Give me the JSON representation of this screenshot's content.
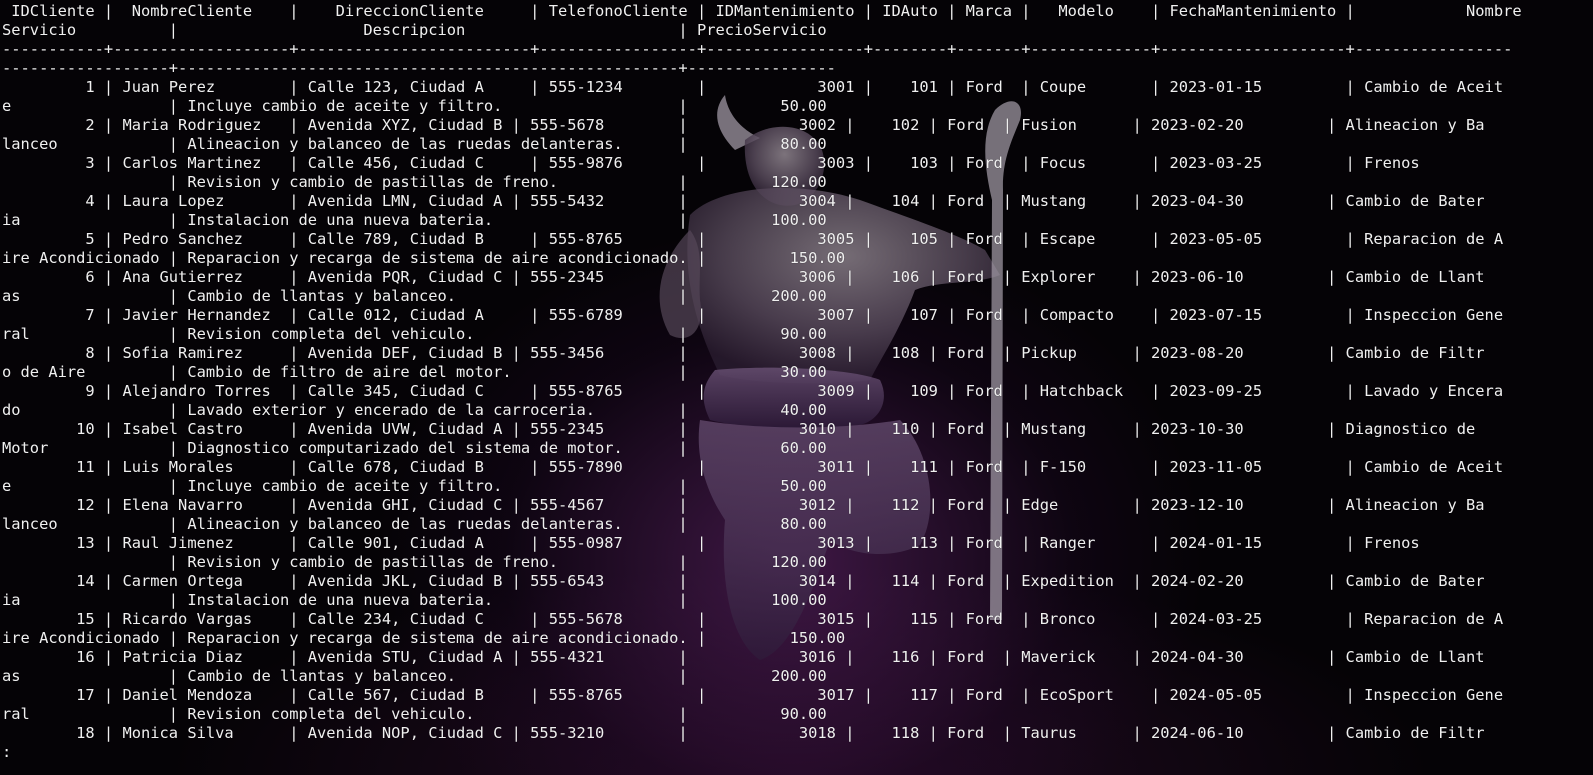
{
  "terminal": {
    "background_color": "#050306",
    "text_color": "#f0f0f0",
    "wallpaper": "minotaur-figure-with-staff",
    "lines": [
      " IDCliente |  NombreCliente    |    DireccionCliente     | TelefonoCliente | IDMantenimiento | IDAuto | Marca |   Modelo    | FechaMantenimiento |            Nombre",
      "Servicio          |                    Descripcion                       | PrecioServicio",
      "-----------+-------------------+-------------------------+-----------------+-----------------+--------+-------+-------------+--------------------+-----------------",
      "------------------+------------------------------------------------------+----------------",
      "         1 | Juan Perez        | Calle 123, Ciudad A     | 555-1234        |            3001 |    101 | Ford  | Coupe       | 2023-01-15         | Cambio de Aceit",
      "e                 | Incluye cambio de aceite y filtro.                   |          50.00",
      "         2 | Maria Rodriguez   | Avenida XYZ, Ciudad B | 555-5678        |            3002 |    102 | Ford  | Fusion      | 2023-02-20         | Alineacion y Ba",
      "lanceo            | Alineacion y balanceo de las ruedas delanteras.      |          80.00",
      "         3 | Carlos Martinez   | Calle 456, Ciudad C     | 555-9876        |            3003 |    103 | Ford  | Focus       | 2023-03-25         | Frenos",
      "                  | Revision y cambio de pastillas de freno.             |         120.00",
      "         4 | Laura Lopez       | Avenida LMN, Ciudad A | 555-5432        |            3004 |    104 | Ford  | Mustang     | 2023-04-30         | Cambio de Bater",
      "ia                | Instalacion de una nueva bateria.                    |         100.00",
      "         5 | Pedro Sanchez     | Calle 789, Ciudad B     | 555-8765        |            3005 |    105 | Ford  | Escape      | 2023-05-05         | Reparacion de A",
      "ire Acondicionado | Reparacion y recarga de sistema de aire acondicionado. |         150.00",
      "         6 | Ana Gutierrez     | Avenida PQR, Ciudad C | 555-2345        |            3006 |    106 | Ford  | Explorer    | 2023-06-10         | Cambio de Llant",
      "as                | Cambio de llantas y balanceo.                        |         200.00",
      "         7 | Javier Hernandez  | Calle 012, Ciudad A     | 555-6789        |            3007 |    107 | Ford  | Compacto    | 2023-07-15         | Inspeccion Gene",
      "ral               | Revision completa del vehiculo.                      |          90.00",
      "         8 | Sofia Ramirez     | Avenida DEF, Ciudad B | 555-3456        |            3008 |    108 | Ford  | Pickup      | 2023-08-20         | Cambio de Filtr",
      "o de Aire         | Cambio de filtro de aire del motor.                  |          30.00",
      "         9 | Alejandro Torres  | Calle 345, Ciudad C     | 555-8765        |            3009 |    109 | Ford  | Hatchback   | 2023-09-25         | Lavado y Encera",
      "do                | Lavado exterior y encerado de la carroceria.         |          40.00",
      "        10 | Isabel Castro     | Avenida UVW, Ciudad A | 555-2345        |            3010 |    110 | Ford  | Mustang     | 2023-10-30         | Diagnostico de",
      "Motor             | Diagnostico computarizado del sistema de motor.      |          60.00",
      "        11 | Luis Morales      | Calle 678, Ciudad B     | 555-7890        |            3011 |    111 | Ford  | F-150       | 2023-11-05         | Cambio de Aceit",
      "e                 | Incluye cambio de aceite y filtro.                   |          50.00",
      "        12 | Elena Navarro     | Avenida GHI, Ciudad C | 555-4567        |            3012 |    112 | Ford  | Edge        | 2023-12-10         | Alineacion y Ba",
      "lanceo            | Alineacion y balanceo de las ruedas delanteras.      |          80.00",
      "        13 | Raul Jimenez      | Calle 901, Ciudad A     | 555-0987        |            3013 |    113 | Ford  | Ranger      | 2024-01-15         | Frenos",
      "                  | Revision y cambio de pastillas de freno.             |         120.00",
      "        14 | Carmen Ortega     | Avenida JKL, Ciudad B | 555-6543        |            3014 |    114 | Ford  | Expedition  | 2024-02-20         | Cambio de Bater",
      "ia                | Instalacion de una nueva bateria.                    |         100.00",
      "        15 | Ricardo Vargas    | Calle 234, Ciudad C     | 555-5678        |            3015 |    115 | Ford  | Bronco      | 2024-03-25         | Reparacion de A",
      "ire Acondicionado | Reparacion y recarga de sistema de aire acondicionado. |         150.00",
      "        16 | Patricia Diaz     | Avenida STU, Ciudad A | 555-4321        |            3016 |    116 | Ford  | Maverick    | 2024-04-30         | Cambio de Llant",
      "as                | Cambio de llantas y balanceo.                        |         200.00",
      "        17 | Daniel Mendoza    | Calle 567, Ciudad B     | 555-8765        |            3017 |    117 | Ford  | EcoSport    | 2024-05-05         | Inspeccion Gene",
      "ral               | Revision completa del vehiculo.                      |          90.00",
      "        18 | Monica Silva      | Avenida NOP, Ciudad C | 555-3210        |            3018 |    118 | Ford  | Taurus      | 2024-06-10         | Cambio de Filtr"
    ],
    "pager_prompt": ":"
  }
}
